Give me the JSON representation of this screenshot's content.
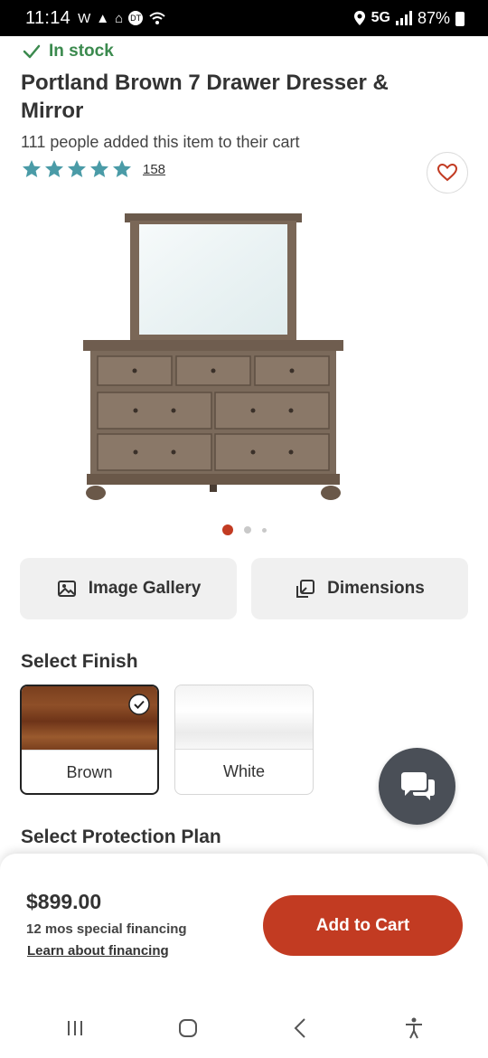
{
  "status_bar": {
    "time": "11:14",
    "notification_icons": [
      "W",
      "▲",
      "⌂",
      "DT"
    ],
    "network": "5G",
    "battery": "87%"
  },
  "product": {
    "stock_label": "In stock",
    "title": "Portland Brown 7 Drawer Dresser & Mirror",
    "cart_count_text": "111 people added this item to their cart",
    "rating": {
      "stars": 5,
      "count": "158"
    }
  },
  "gallery": {
    "dots": 3,
    "active_dot": 0
  },
  "actions": {
    "image_gallery_label": "Image Gallery",
    "dimensions_label": "Dimensions"
  },
  "finish": {
    "title": "Select Finish",
    "options": [
      {
        "label": "Brown",
        "selected": true
      },
      {
        "label": "White",
        "selected": false
      }
    ]
  },
  "protection": {
    "title": "Select Protection Plan"
  },
  "cart": {
    "price": "$899.00",
    "financing_text": "12 mos special financing",
    "learn_link": "Learn about financing",
    "add_button": "Add to Cart"
  },
  "colors": {
    "accent_red": "#c23b22",
    "star_teal": "#4a9ba7",
    "stock_green": "#3b8a4e"
  }
}
